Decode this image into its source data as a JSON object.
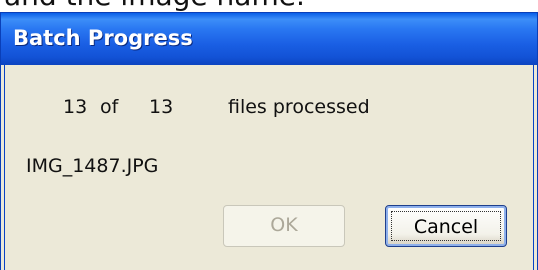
{
  "top_caption": "and the image name.",
  "dialog": {
    "title": "Batch Progress",
    "progress": {
      "current": "13",
      "of_label": "of",
      "total": "13",
      "status_label": "files processed"
    },
    "current_file": "IMG_1487.JPG",
    "buttons": {
      "ok_label": "OK",
      "ok_enabled": false,
      "cancel_label": "Cancel"
    }
  },
  "colors": {
    "title_bar": "#1a5fe4",
    "dialog_face": "#ece9d8",
    "title_text": "#ffffff",
    "disabled_text": "#aca899"
  }
}
